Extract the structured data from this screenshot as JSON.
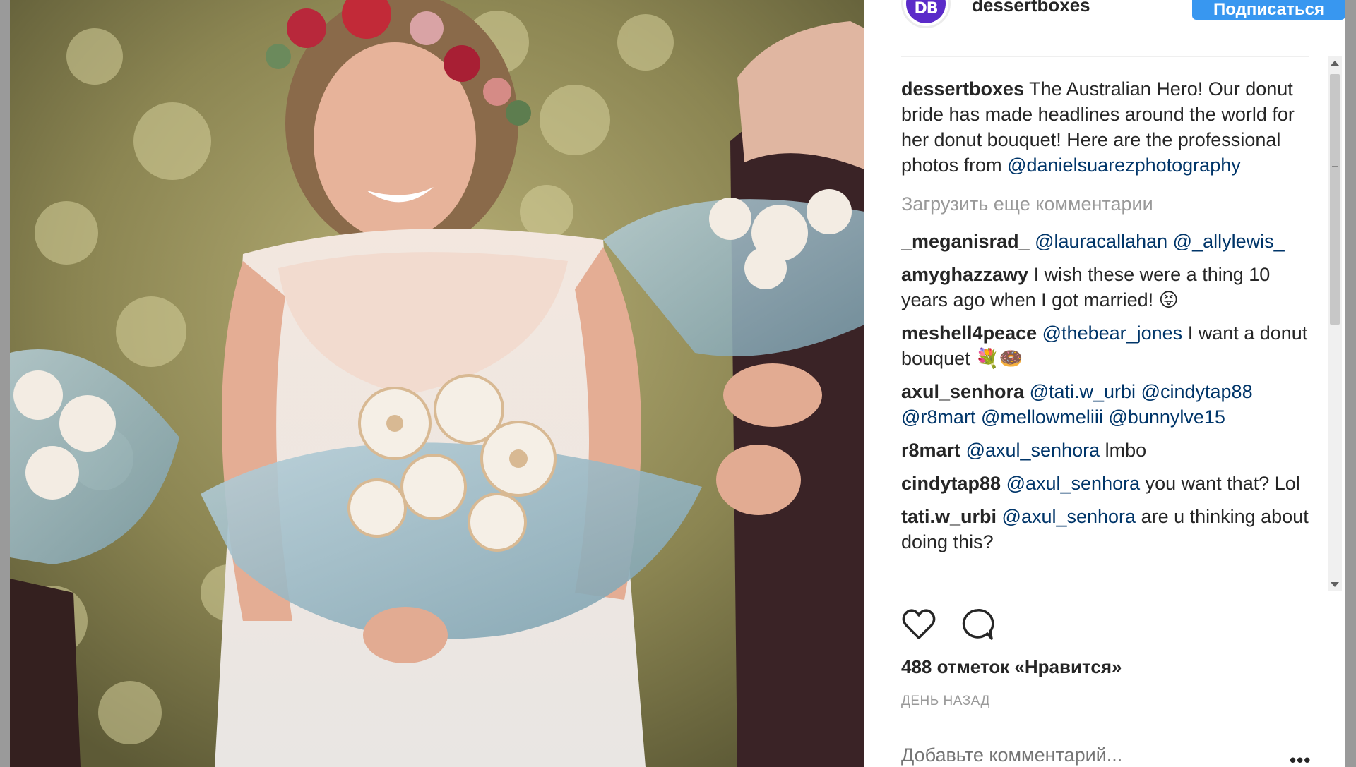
{
  "header": {
    "avatar_text": "DB",
    "username": "dessertboxes",
    "follow_label": "Подписаться"
  },
  "caption": {
    "username": "dessertboxes",
    "text": "The Australian Hero! Our donut bride has made headlines around the world for her donut bouquet! Here are the professional photos from",
    "mention": "@danielsuarezphotography"
  },
  "load_more_label": "Загрузить еще комментарии",
  "comments": [
    {
      "user": "_meganisrad_",
      "parts": [
        {
          "t": "@lauracallahan",
          "link": true
        },
        {
          "t": " ",
          "link": false
        },
        {
          "t": "@_allylewis_",
          "link": true
        }
      ]
    },
    {
      "user": "amyghazzawy",
      "parts": [
        {
          "t": "I wish these were a thing 10 years ago when I got married! 😝",
          "link": false
        }
      ]
    },
    {
      "user": "meshell4peace",
      "parts": [
        {
          "t": "@thebear_jones",
          "link": true
        },
        {
          "t": " I want a donut bouquet 💐🍩",
          "link": false
        }
      ]
    },
    {
      "user": "axul_senhora",
      "parts": [
        {
          "t": "@tati.w_urbi",
          "link": true
        },
        {
          "t": " ",
          "link": false
        },
        {
          "t": "@cindytap88",
          "link": true
        },
        {
          "t": " ",
          "link": false
        },
        {
          "t": "@r8mart",
          "link": true
        },
        {
          "t": " ",
          "link": false
        },
        {
          "t": "@mellowmeliii",
          "link": true
        },
        {
          "t": " ",
          "link": false
        },
        {
          "t": "@bunnylve15",
          "link": true
        }
      ]
    },
    {
      "user": "r8mart",
      "parts": [
        {
          "t": "@axul_senhora",
          "link": true
        },
        {
          "t": " lmbo",
          "link": false
        }
      ]
    },
    {
      "user": "cindytap88",
      "parts": [
        {
          "t": "@axul_senhora",
          "link": true
        },
        {
          "t": " you want that? Lol",
          "link": false
        }
      ]
    },
    {
      "user": "tati.w_urbi",
      "parts": [
        {
          "t": "@axul_senhora",
          "link": true
        },
        {
          "t": " are u thinking about doing this?",
          "link": false
        }
      ]
    }
  ],
  "actions": {
    "like_icon": "heart-icon",
    "comment_icon": "comment-icon"
  },
  "likes_text": "488 отметок «Нравится»",
  "time_text": "ДЕНЬ НАЗАД",
  "add_comment_placeholder": "Добавьте комментарий...",
  "more_icon": "more-dots-icon",
  "colors": {
    "link": "#003569",
    "follow_button": "#3897f0",
    "muted": "#999999",
    "avatar": "#5b2bc9"
  }
}
